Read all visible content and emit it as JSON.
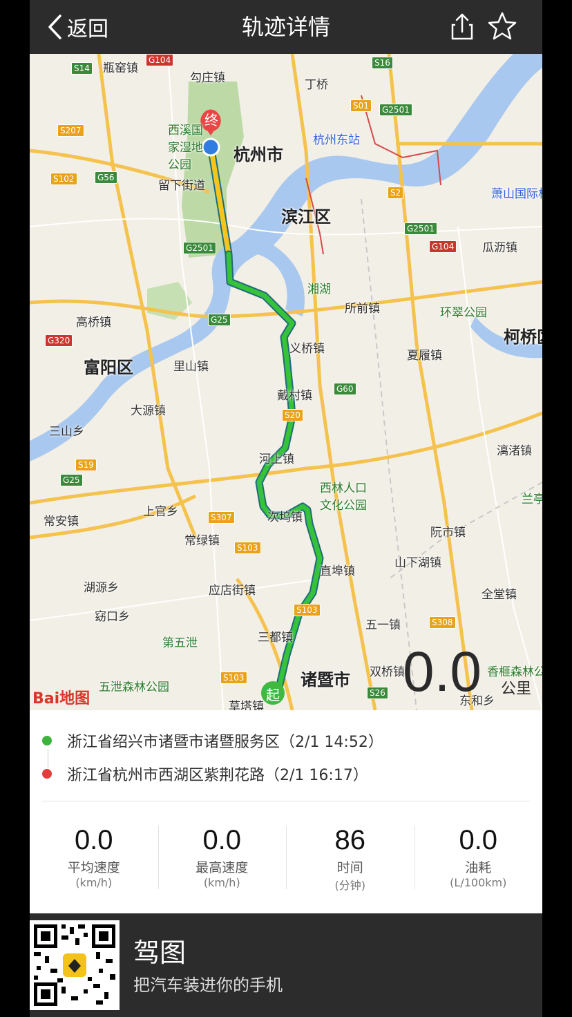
{
  "nav": {
    "back_label": "返回",
    "title": "轨迹详情",
    "share_icon": "share-icon",
    "star_icon": "star-icon"
  },
  "map": {
    "labels": {
      "hangzhou": "杭州市",
      "binjiang": "滨江区",
      "fuyang": "富阳区",
      "zhuji": "诸暨市",
      "kehao": "柯桥区",
      "pinguzhen": "瓶窑镇",
      "gouzhuang": "勾庄镇",
      "dingqiao": "丁桥",
      "xixi": "西溪国家湿地公园",
      "liuxia": "留下街道",
      "east_station": "杭州东站",
      "xiaoshan": "萧山国际机场",
      "guali": "瓜沥镇",
      "xianghu": "湘湖",
      "suoqian": "所前镇",
      "huancui": "环翠公园",
      "gaoqiao": "高桥镇",
      "lishan": "里山镇",
      "yiqiao": "义桥镇",
      "xialv": "夏履镇",
      "daibu": "戴村镇",
      "dayuan": "大源镇",
      "sanshan": "三山乡",
      "heshang": "河上镇",
      "lipu": "漓渚镇",
      "xilin": "西林人口文化公园",
      "lanting": "兰亭镇",
      "changan": "常安镇",
      "shangguan": "上官乡",
      "cilian": "次坞镇",
      "changlv": "常绿镇",
      "ruanshi": "阮市镇",
      "shanxiahu": "山下湖镇",
      "huyuan": "湖源乡",
      "yingdian": "应店街镇",
      "zhibu": "直埠镇",
      "quankang": "全堂镇",
      "kuokou": "窈口乡",
      "wuyi": "五一镇",
      "diwuxie": "第五泄",
      "sandu": "三都镇",
      "shuangqiao": "双桥镇",
      "xiangfei": "香榧森林公园",
      "wuxie": "五泄森林公园",
      "caota": "草塔镇",
      "donghe": "东和乡"
    },
    "shields": [
      "S14",
      "G104",
      "S16",
      "S01",
      "G2501",
      "S207",
      "S2",
      "G56",
      "S102",
      "G2501",
      "G2501",
      "G104",
      "G25",
      "G320",
      "S20",
      "G60",
      "S19",
      "G25",
      "S307",
      "S103",
      "S103",
      "S308",
      "S26",
      "S103"
    ],
    "start_marker": "起",
    "end_marker": "终",
    "baidu_logo": "Bai地图",
    "distance": {
      "value": "0.0",
      "unit": "公里"
    }
  },
  "trip": {
    "start": {
      "place": "浙江省绍兴市诸暨市诸暨服务区",
      "time": "（2/1 14:52）",
      "color": "#3db33d"
    },
    "end": {
      "place": "浙江省杭州市西湖区紫荆花路",
      "time": "（2/1 16:17）",
      "color": "#e03d3d"
    }
  },
  "stats": [
    {
      "value": "0.0",
      "label": "平均速度",
      "unit": "(km/h)"
    },
    {
      "value": "0.0",
      "label": "最高速度",
      "unit": "(km/h)"
    },
    {
      "value": "86",
      "label": "时间",
      "unit": "(分钟)"
    },
    {
      "value": "0.0",
      "label": "油耗",
      "unit": "(L/100km)"
    }
  ],
  "footer": {
    "app_name": "驾图",
    "slogan": "把汽车装进你的手机",
    "qr_icon": "qr-code-icon"
  }
}
